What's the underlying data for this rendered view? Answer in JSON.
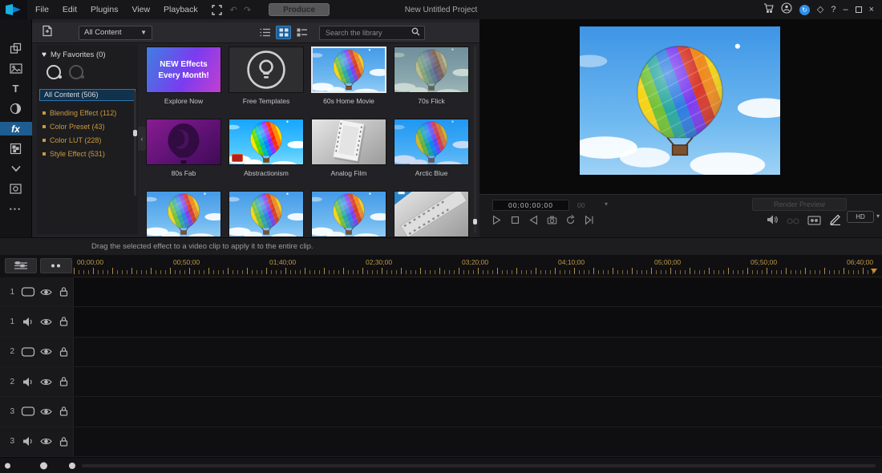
{
  "titlebar": {
    "menus": [
      "File",
      "Edit",
      "Plugins",
      "View",
      "Playback"
    ],
    "produce_label": "Produce",
    "project_title": "New Untitled Project",
    "help_label": "?",
    "minimize_label": "–",
    "close_label": "×",
    "diamond_label": "◇"
  },
  "rooms": {
    "title_letter": "T",
    "fx_label": "fx",
    "more_label": "•••",
    "chevron": "∨"
  },
  "library": {
    "dropdown_value": "All Content",
    "dropdown_caret": "▼",
    "search_placeholder": "Search the library",
    "tree": {
      "favorites": "My Favorites (0)",
      "heart": "♥",
      "all_content": "All Content (506)",
      "categories": [
        "Blending Effect  (112)",
        "Color Preset  (43)",
        "Color LUT  (228)",
        "Style Effect  (531)"
      ]
    },
    "collapse_arrow": "‹",
    "items": [
      {
        "label": "Explore Now",
        "promo1": "NEW Effects",
        "promo2": "Every Month!"
      },
      {
        "label": "Free Templates"
      },
      {
        "label": "60s Home Movie"
      },
      {
        "label": "70s Flick"
      },
      {
        "label": "80s Fab"
      },
      {
        "label": "Abstractionism"
      },
      {
        "label": "Analog Film"
      },
      {
        "label": "Arctic Blue"
      }
    ]
  },
  "preview": {
    "timecode": "00;00;00;00",
    "fps": "00",
    "caret": "▾",
    "render_button": "Render Preview",
    "quality": "HD",
    "quality_caret": "▾"
  },
  "status_hint": "Drag the selected effect to a video clip to apply it to the entire clip.",
  "timeline": {
    "ruler": [
      "00;00;00",
      "00;50;00",
      "01;40;00",
      "02;30;00",
      "03;20;00",
      "04;10;00",
      "05;00;00",
      "05;50;00",
      "06;40;00"
    ],
    "tracks": [
      {
        "num": "1",
        "kind": "video"
      },
      {
        "num": "1",
        "kind": "audio"
      },
      {
        "num": "2",
        "kind": "video"
      },
      {
        "num": "2",
        "kind": "audio"
      },
      {
        "num": "3",
        "kind": "video"
      },
      {
        "num": "3",
        "kind": "audio"
      }
    ]
  },
  "colors": {
    "accent_blue": "#1f5c8f",
    "category_orange": "#c9993d",
    "ruler_text": "#bf9a42",
    "sync_badge_blue": "#2f8fe8"
  }
}
